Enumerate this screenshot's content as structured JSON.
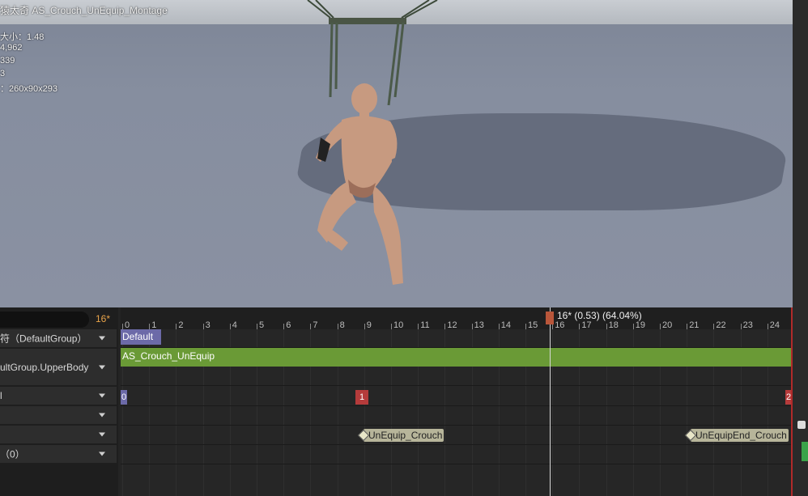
{
  "viewport": {
    "title": "猿太奇 AS_Crouch_UnEquip_Montage",
    "stats": [
      "大小：1.48",
      "4,962",
      "339",
      "3",
      "：260x90x293"
    ]
  },
  "timeline": {
    "current_frame_label": "16*",
    "playhead_text": "16* (0.53) (64.04%)",
    "ruler_ticks": [
      "0",
      "1",
      "2",
      "3",
      "4",
      "5",
      "6",
      "7",
      "8",
      "9",
      "10",
      "11",
      "12",
      "13",
      "14",
      "15",
      "16",
      "17",
      "18",
      "19",
      "20",
      "21",
      "22",
      "23",
      "24"
    ],
    "tracks": [
      {
        "label": "符（DefaultGroup）"
      },
      {
        "label": "ultGroup.UpperBody"
      },
      {
        "label": "l"
      },
      {
        "label": ""
      },
      {
        "label": ""
      },
      {
        "label": "（0）"
      }
    ],
    "default_tag": "Default",
    "montage_segment": "AS_Crouch_UnEquip",
    "section_markers": [
      "0",
      "1",
      "2"
    ],
    "notifies": [
      "UnEquip_Crouch",
      "UnEquipEnd_Crouch"
    ]
  },
  "colors": {
    "playhead": "#b9563a",
    "segment": "#6a9a36",
    "default_tag": "#6c6aa8",
    "section_marker_red": "#b53b3b",
    "accent_frame": "#e8a34a"
  }
}
